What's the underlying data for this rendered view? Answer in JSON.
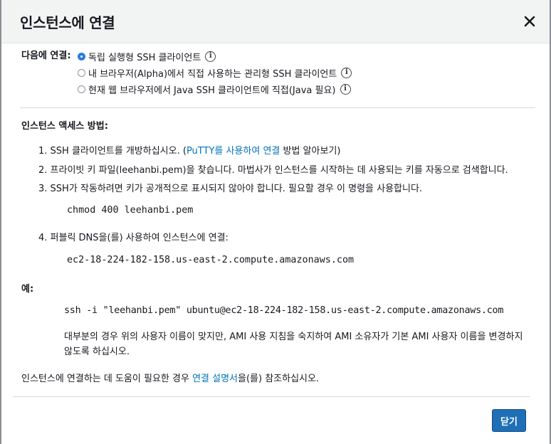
{
  "dialog": {
    "title": "인스턴스에 연결",
    "close_icon": "close-icon"
  },
  "connect": {
    "label": "다음에 연결:",
    "options": [
      {
        "label": "독립 실행형 SSH 클라이언트",
        "selected": true
      },
      {
        "label": "내 브라우저(Alpha)에서 직접 사용하는 관리형 SSH 클라이언트",
        "selected": false
      },
      {
        "label": "현재 웹 브라우저에서 Java SSH 클라이언트에 직접(Java 필요)",
        "selected": false
      }
    ],
    "info_icon": "info-icon"
  },
  "access": {
    "title": "인스턴스 액세스 방법:",
    "step1_prefix": "1. SSH 클라이언트를 개방하십시오. (",
    "step1_link": "PuTTY를 사용하여 연결",
    "step1_suffix": " 방법 알아보기)",
    "step2": "2. 프라이빗 키 파일(leehanbi.pem)을 찾습니다. 마법사가 인스턴스를 시작하는 데 사용되는 키를 자동으로 검색합니다.",
    "step3": "3. SSH가 작동하려면 키가 공개적으로 표시되지 않아야 합니다. 필요할 경우 이 명령을 사용합니다.",
    "chmod_cmd": "chmod 400 leehanbi.pem",
    "step4": "4. 퍼블릭 DNS을(를) 사용하여 인스턴스에 연결:",
    "dns": "ec2-18-224-182-158.us-east-2.compute.amazonaws.com"
  },
  "example": {
    "title": "예:",
    "ssh_cmd": "ssh -i \"leehanbi.pem\" ubuntu@ec2-18-224-182-158.us-east-2.compute.amazonaws.com",
    "note": "대부분의 경우 위의 사용자 이름이 맞지만, AMI 사용 지침을 숙지하여 AMI 소유자가 기본 AMI 사용자 이름을 변경하지 않도록 하십시오."
  },
  "help": {
    "prefix": "인스턴스에 연결하는 데 도움이 필요한 경우 ",
    "link": "연결 설명서",
    "suffix": "을(를) 참조하십시오."
  },
  "footer": {
    "close_label": "닫기"
  },
  "colors": {
    "link": "#0073bb",
    "primary_button": "#1f6fb7",
    "header_bg": "#f2f3f3"
  }
}
